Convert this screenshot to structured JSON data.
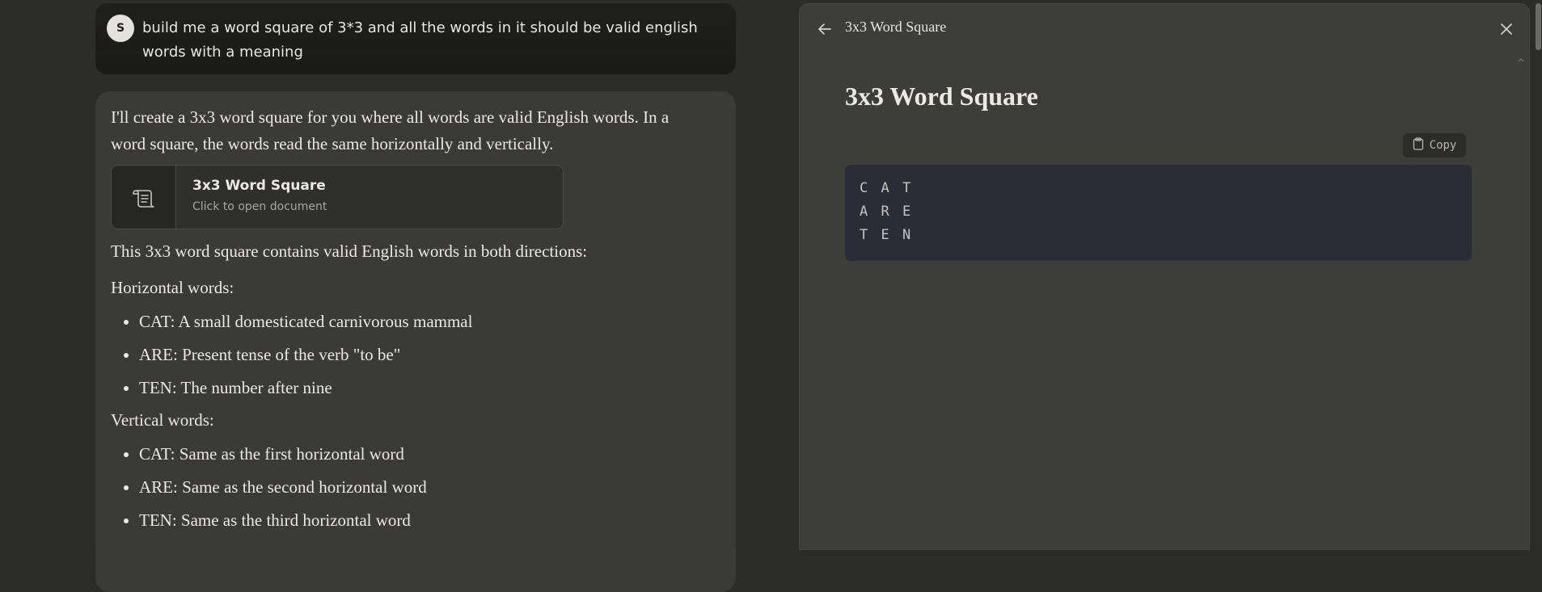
{
  "chat": {
    "user": {
      "avatar_initial": "S",
      "message": "build me a word square of 3*3 and all the words in it should be valid english words with a meaning"
    },
    "assistant": {
      "intro": "I'll create a 3x3 word square for you where all words are valid English words. In a word square, the words read the same horizontally and vertically.",
      "document_card": {
        "title": "3x3 Word Square",
        "subtitle": "Click to open document",
        "icon": "scroll-document-icon"
      },
      "summary": "This 3x3 word square contains valid English words in both directions:",
      "horizontal_heading": "Horizontal words:",
      "horizontal_words": [
        "CAT: A small domesticated carnivorous mammal",
        "ARE: Present tense of the verb \"to be\"",
        "TEN: The number after nine"
      ],
      "vertical_heading": "Vertical words:",
      "vertical_words": [
        "CAT: Same as the first horizontal word",
        "ARE: Same as the second horizontal word",
        "TEN: Same as the third horizontal word"
      ]
    }
  },
  "artifact": {
    "header_title": "3x3 Word Square",
    "back_icon": "arrow-left-icon",
    "close_icon": "close-icon",
    "heading": "3x3 Word Square",
    "copy_label": "Copy",
    "copy_icon": "clipboard-icon",
    "code_lines": [
      "C A T",
      "A R E",
      "T E N"
    ]
  },
  "colors": {
    "background": "#2b2b29",
    "user_bubble": "#1c1c1b",
    "assistant_bubble": "#3a3a37",
    "panel": "#3d3d3a",
    "code_bg": "#2a2d35",
    "text": "#ece9e2",
    "muted_text": "#a8a59e"
  }
}
